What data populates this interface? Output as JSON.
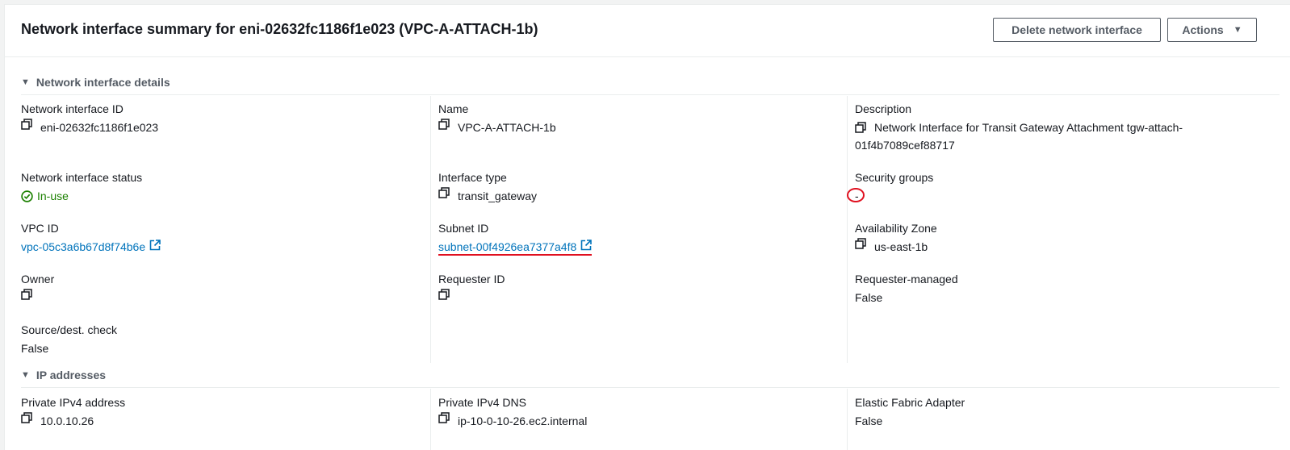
{
  "header": {
    "title": "Network interface summary for eni-02632fc1186f1e023 (VPC-A-ATTACH-1b)",
    "delete_button": "Delete network interface",
    "actions_button": "Actions"
  },
  "sections": {
    "details": "Network interface details",
    "ip": "IP addresses"
  },
  "details": {
    "eni_id": {
      "label": "Network interface ID",
      "value": "eni-02632fc1186f1e023"
    },
    "name": {
      "label": "Name",
      "value": "VPC-A-ATTACH-1b"
    },
    "description": {
      "label": "Description",
      "value": "Network Interface for Transit Gateway Attachment tgw-attach-01f4b7089cef88717"
    },
    "status": {
      "label": "Network interface status",
      "value": "In-use"
    },
    "interface_type": {
      "label": "Interface type",
      "value": "transit_gateway"
    },
    "security_groups": {
      "label": "Security groups",
      "value": "-"
    },
    "vpc_id": {
      "label": "VPC ID",
      "value": "vpc-05c3a6b67d8f74b6e"
    },
    "subnet_id": {
      "label": "Subnet ID",
      "value": "subnet-00f4926ea7377a4f8"
    },
    "availability_zone": {
      "label": "Availability Zone",
      "value": "us-east-1b"
    },
    "owner": {
      "label": "Owner",
      "value": ""
    },
    "requester_id": {
      "label": "Requester ID",
      "value": ""
    },
    "requester_managed": {
      "label": "Requester-managed",
      "value": "False"
    },
    "source_dest_check": {
      "label": "Source/dest. check",
      "value": "False"
    }
  },
  "ip": {
    "private_ipv4": {
      "label": "Private IPv4 address",
      "value": "10.0.10.26"
    },
    "private_dns": {
      "label": "Private IPv4 DNS",
      "value": "ip-10-0-10-26.ec2.internal"
    },
    "efa": {
      "label": "Elastic Fabric Adapter",
      "value": "False"
    }
  },
  "icons": {
    "copy": "copy-icon",
    "external": "external-link-icon",
    "status": "check-circle-icon",
    "collapse": "caret-down-icon"
  },
  "colors": {
    "link": "#0073bb",
    "success": "#1d8102",
    "annotation": "#e0101f"
  }
}
